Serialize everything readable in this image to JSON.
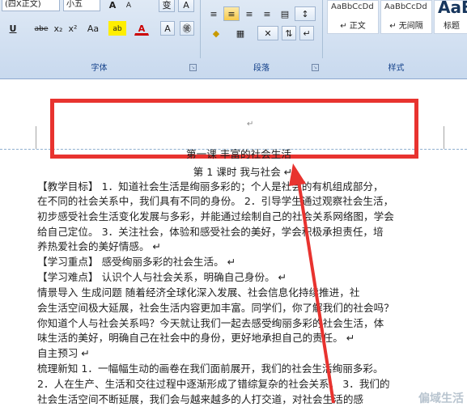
{
  "ribbon": {
    "font_group": {
      "label": "字体",
      "font_name": "(四X正文)",
      "font_size": "小五",
      "buttons": [
        "U",
        "abe",
        "x₂",
        "x²",
        "Aa",
        "ab",
        "A",
        "A",
        "㊝"
      ],
      "top_buttons": [
        "A",
        "A",
        "变",
        "A"
      ]
    },
    "paragraph_group": {
      "label": "段落",
      "buttons": [
        "≡",
        "≡",
        "≡",
        "≡",
        "▤",
        "↕",
        "◆",
        "▦",
        "✕",
        "⇅",
        "↵"
      ]
    },
    "styles_group": {
      "label": "样式",
      "tiles": [
        {
          "sample": "AaBbCcDd",
          "name": "↵ 正文"
        },
        {
          "sample": "AaBbCcDd",
          "name": "↵ 无间隔"
        },
        {
          "sample": "AaB",
          "name": "标题"
        }
      ]
    }
  },
  "document": {
    "header_mark": "↵",
    "title": "第一课 丰富的社会生活",
    "subtitle": "第 1 课时  我与社会 ↵",
    "lines": [
      "【教学目标】  1．知道社会生活是绚丽多彩的；个人是社会的有机组成部分，",
      "在不同的社会关系中，我们具有不同的身份。 2．引导学生通过观察社会生活，",
      "初步感受社会生活变化发展与多彩，并能通过绘制自己的社会关系网络图，学会",
      "给自己定位。  3．关注社会，体验和感受社会的美好，学会积极承担责任，培",
      "养热爱社会的美好情感。 ↵",
      "【学习重点】  感受绚丽多彩的社会生活。    ↵",
      "【学习难点】  认识个人与社会关系，明确自己身份。  ↵",
      "    情景导入  生成问题  随着经济全球化深入发展、社会信息化持续推进，社",
      "会生活空间极大延展，社会生活内容更加丰富。同学们，你了解我们的社会吗？",
      "你知道个人与社会关系吗？今天就让我们一起去感受绚丽多彩的社会生活，体",
      "味生活的美好，明确自己在社会中的身份，更好地承担自己的责任。    ↵",
      "自主预习 ↵",
      "梳理新知  1．一幅幅生动的画卷在我们面前展开，我们的社会生活绚丽多彩。",
      "2．人在生产、生活和交往过程中逐渐形成了错综复杂的社会关系。  3．我们的",
      "社会生活空间不断延展，我们会与越来越多的人打交道，对社会生活的感"
    ]
  },
  "watermark": "偏域生活",
  "colors": {
    "highlight_box": "#e8332f",
    "arrow": "#e8332f"
  }
}
